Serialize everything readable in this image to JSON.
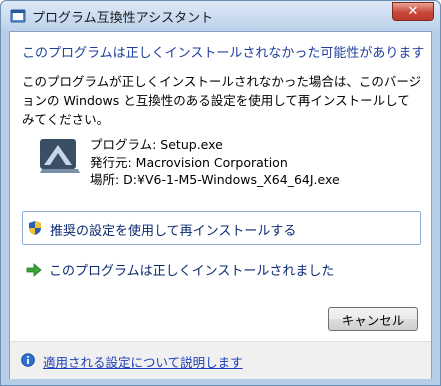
{
  "window": {
    "title": "プログラム互換性アシスタント",
    "close_label": "✕"
  },
  "content": {
    "headline": "このプログラムは正しくインストールされなかった可能性があります",
    "description": "このプログラムが正しくインストールされなかった場合は、このバージョンの Windows と互換性のある設定を使用して再インストールしてみてください。",
    "program": {
      "name": "プログラム: Setup.exe",
      "publisher": "発行元: Macrovision Corporation",
      "location": "場所: D:¥V6-1-M5-Windows_X64_64J.exe"
    },
    "options": {
      "reinstall_label": "推奨の設定を使用して再インストールする",
      "installed_ok_label": "このプログラムは正しくインストールされました"
    },
    "cancel_label": "キャンセル"
  },
  "footer": {
    "help_link": "適用される設定について説明します"
  },
  "icons": {
    "title": "program-compatibility-icon",
    "program": "installer-icon",
    "shield": "uac-shield-icon",
    "arrow": "green-arrow-icon",
    "info": "info-icon"
  },
  "colors": {
    "headline": "#1f3f9c",
    "option_text": "#0b2a73",
    "link": "#1c3fb5",
    "close_button": "#c8473a"
  }
}
